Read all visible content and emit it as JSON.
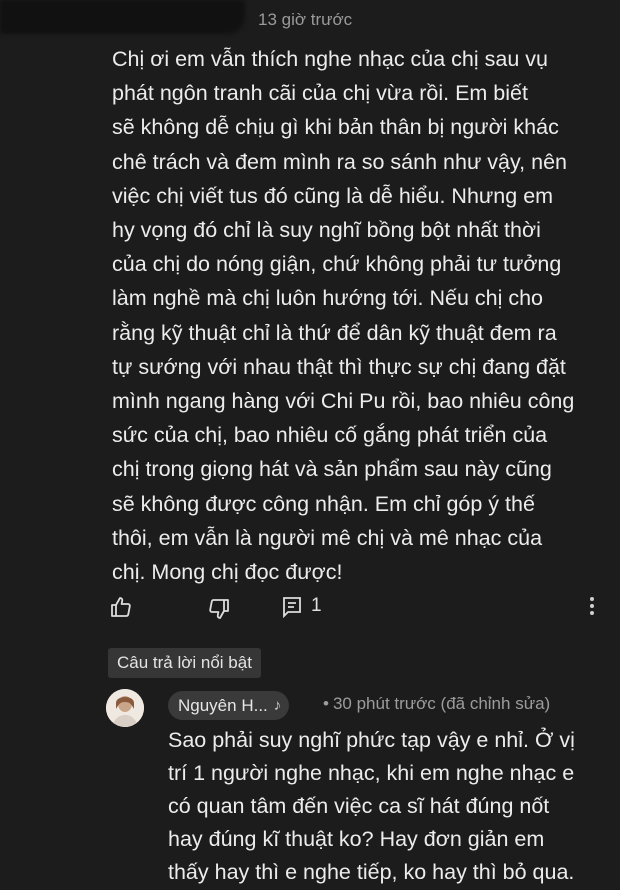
{
  "comment": {
    "timestamp": "13 giờ trước",
    "lines": [
      "Chị ơi em vẫn thích nghe nhạc của chị sau vụ",
      "phát ngôn tranh cãi của chị vừa rồi. Em biết",
      "sẽ không dễ chịu gì khi bản thân bị người khác",
      "chê trách và đem mình ra so sánh như vậy, nên",
      "việc chị viết tus đó cũng là dễ hiểu. Nhưng em",
      "hy vọng đó chỉ là suy nghĩ bồng bột nhất thời",
      "của chị do nóng giận, chứ không phải tư tưởng",
      "làm nghề mà chị luôn hướng tới. Nếu chị cho",
      "rằng kỹ thuật chỉ là thứ để dân kỹ thuật đem ra",
      "tự sướng với nhau thật thì thực sự chị đang đặt",
      "mình ngang hàng với Chi Pu rồi, bao nhiêu công",
      "sức của chị, bao nhiêu cố gắng phát triển của",
      "chị trong giọng hát và sản phẩm sau này cũng",
      "sẽ không được công nhận. Em chỉ góp ý thế",
      "thôi, em vẫn là người mê chị và mê nhạc của",
      "chị. Mong chị đọc được!"
    ],
    "actions": {
      "like_icon": "thumbs-up-icon",
      "dislike_icon": "thumbs-down-icon",
      "reply_icon": "reply-comment-icon",
      "reply_count": "1",
      "more_icon": "more-vertical-icon"
    }
  },
  "featured_reply": {
    "badge": "Câu trả lời nổi bật",
    "author": "Nguyên H...",
    "author_badge_icon": "music-note-icon",
    "author_badge": "♪",
    "meta_separator": "•",
    "meta": "30 phút trước (đã chỉnh sửa)",
    "lines": [
      "Sao phải suy nghĩ phức tạp vậy e nhỉ. Ở vị",
      "trí 1 người nghe nhạc, khi em nghe nhạc e",
      "có quan tâm đến việc ca sĩ hát đúng nốt",
      "hay đúng kĩ thuật ko? Hay đơn giản em",
      "thấy hay thì e nghe tiếp, ko hay thì bỏ qua."
    ]
  }
}
